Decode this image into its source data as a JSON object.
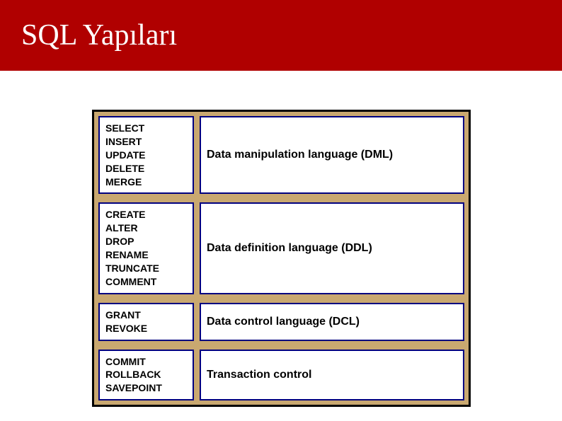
{
  "header": {
    "title": "SQL Yapıları"
  },
  "rows": [
    {
      "commands": [
        "SELECT",
        "INSERT",
        "UPDATE",
        "DELETE",
        "MERGE"
      ],
      "description": "Data manipulation language (DML)"
    },
    {
      "commands": [
        "CREATE",
        "ALTER",
        "DROP",
        "RENAME",
        "TRUNCATE",
        "COMMENT"
      ],
      "description": "Data definition language (DDL)"
    },
    {
      "commands": [
        "GRANT",
        "REVOKE"
      ],
      "description": "Data control language (DCL)"
    },
    {
      "commands": [
        "COMMIT",
        "ROLLBACK",
        "SAVEPOINT"
      ],
      "description": "Transaction control"
    }
  ]
}
